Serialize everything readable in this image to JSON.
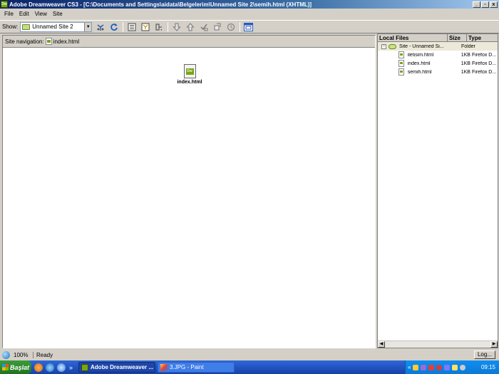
{
  "window": {
    "app_icon": "Dw",
    "title": "Adobe Dreamweaver CS3 - [C:\\Documents and Settings\\aidata\\Belgelerim\\Unnamed Site 2\\semih.html (XHTML)]",
    "minimize": "_",
    "maximize": "▫",
    "close": "x"
  },
  "menu": {
    "file": "File",
    "edit": "Edit",
    "view": "View",
    "site": "Site"
  },
  "toolbar": {
    "show_label": "Show:",
    "site_value": "Unnamed Site 2",
    "icons": [
      "connect-icon",
      "refresh-icon",
      "site-files-icon",
      "site-map-icon",
      "expand-icon",
      "get-icon",
      "put-icon",
      "check-out-icon",
      "check-in-icon",
      "sync-icon",
      "expand-panel-icon"
    ]
  },
  "site_map": {
    "nav_label": "Site navigation:",
    "nav_file": "index.html",
    "home_file": "index.html"
  },
  "local_files": {
    "columns": [
      "Local Files",
      "Size",
      "Type"
    ],
    "root": {
      "name": "Site - Unnamed Si...",
      "size": "",
      "type": "Folder",
      "toggle": "−"
    },
    "files": [
      {
        "name": "iletisim.html",
        "size": "1KB",
        "type": "Firefox D..."
      },
      {
        "name": "index.html",
        "size": "1KB",
        "type": "Firefox D..."
      },
      {
        "name": "semih.html",
        "size": "1KB",
        "type": "Firefox D..."
      }
    ]
  },
  "statusbar": {
    "zoom": "100%",
    "status": "Ready",
    "log_button": "Log..."
  },
  "taskbar": {
    "start_label": "Başlat",
    "overflow": "»",
    "tasks": [
      {
        "label": "Adobe Dreamweaver ...",
        "active": true
      },
      {
        "label": "3.JPG - Paint",
        "active": false
      }
    ],
    "tray_expand": "«",
    "clock": "09:15"
  },
  "colors": {
    "accent": "#0a246a",
    "dreamweaver_green": "#7aa318",
    "taskbar_blue": "#2457c8",
    "start_green": "#2f8a2f"
  }
}
